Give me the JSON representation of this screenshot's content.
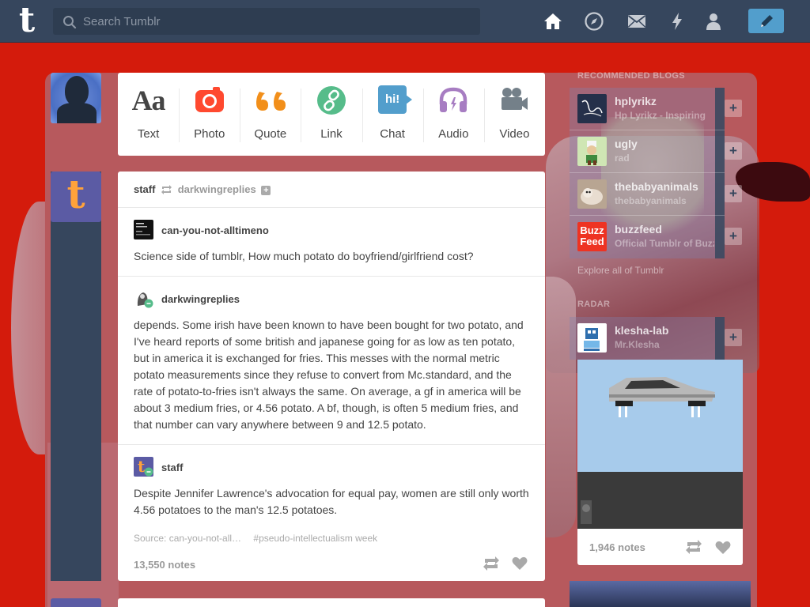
{
  "topbar": {
    "logo_letter": "t",
    "search_placeholder": "Search Tumblr",
    "nav_icons": [
      "home-icon",
      "explore-icon",
      "mail-icon",
      "activity-icon",
      "account-icon"
    ],
    "compose_icon": "pencil-icon"
  },
  "post_types": [
    {
      "label": "Text",
      "icon": "text-icon",
      "glyph": "Aa",
      "color": "#444444"
    },
    {
      "label": "Photo",
      "icon": "camera-icon",
      "color": "#ff492f"
    },
    {
      "label": "Quote",
      "icon": "quote-icon",
      "glyph": "66",
      "color": "#f28f1a"
    },
    {
      "label": "Link",
      "icon": "link-icon",
      "color": "#56bc8a"
    },
    {
      "label": "Chat",
      "icon": "chat-icon",
      "glyph": "hi!",
      "color": "#529ecc"
    },
    {
      "label": "Audio",
      "icon": "headphones-icon",
      "color": "#a77dc2"
    },
    {
      "label": "Video",
      "icon": "video-camera-icon",
      "color": "#748089"
    }
  ],
  "post": {
    "author": "staff",
    "reblogged_from": "darkwingreplies",
    "trail": [
      {
        "username": "can-you-not-alltimeno",
        "text": "Science side of tumblr, How much potato do boyfriend/girlfriend cost?"
      },
      {
        "username": "darkwingreplies",
        "text": "depends. Some irish have been known to have been bought for two potato, and I've heard reports of some british and japanese going for as low as ten potato, but in america it is exchanged for fries. This messes with the normal metric potato measurements since they refuse to convert from Mc.standard, and the rate of potato-to-fries isn't always the same. On average, a gf in america will be about 3 medium fries, or 4.56 potato. A bf, though, is often 5 medium fries, and that number can vary anywhere between 9 and 12.5 potato."
      },
      {
        "username": "staff",
        "text": "Despite Jennifer Lawrence's advocation for equal pay, women are still only worth 4.56 potatoes to the man's 12.5 potatoes."
      }
    ],
    "source": "Source: can-you-not-all…",
    "tag": "#pseudo-intellectualism week",
    "notes": "13,550 notes"
  },
  "sidebar": {
    "recommended_heading": "RECOMMENDED BLOGS",
    "recommended": [
      {
        "name": "hplyrikz",
        "subtitle": "Hp Lyrikz - Inspiring"
      },
      {
        "name": "ugly",
        "subtitle": "rad"
      },
      {
        "name": "thebabyanimals",
        "subtitle": "thebabyanimals"
      },
      {
        "name": "buzzfeed",
        "subtitle": "Official Tumblr of BuzzFeed",
        "logo_text": "Buzz Feed"
      }
    ],
    "explore_link": "Explore all of Tumblr",
    "radar_heading": "RADAR",
    "radar": {
      "name": "klesha-lab",
      "subtitle": "Mr.Klesha",
      "notes": "1,946 notes"
    }
  }
}
